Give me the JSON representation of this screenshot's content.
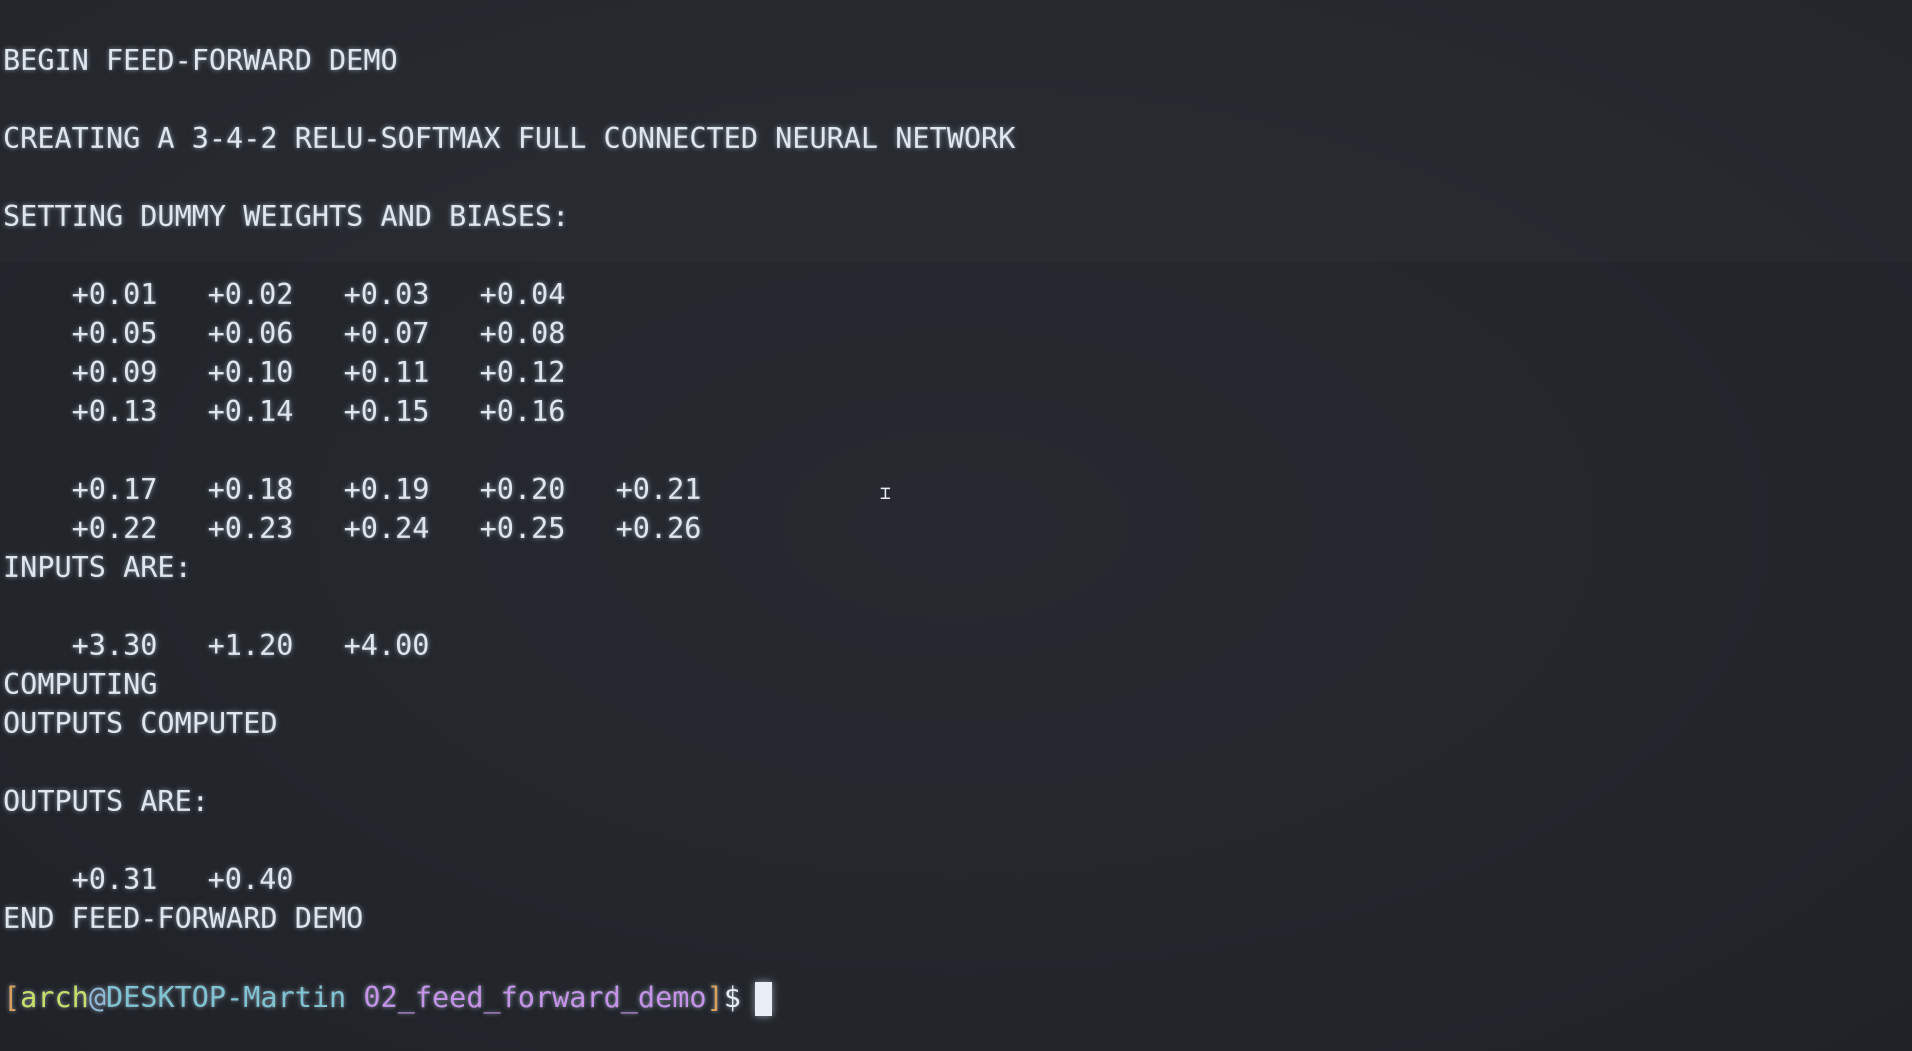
{
  "terminal": {
    "lines": {
      "begin": "BEGIN FEED-FORWARD DEMO",
      "creating": "CREATING A 3-4-2 RELU-SOFTMAX FULL CONNECTED NEURAL NETWORK",
      "setting": "SETTING DUMMY WEIGHTS AND BIASES:",
      "inputs_header": "INPUTS ARE:",
      "computing": "COMPUTING",
      "outputs_computed": "OUTPUTS COMPUTED",
      "outputs_header": "OUTPUTS ARE:",
      "end": "END FEED-FORWARD DEMO"
    },
    "weights_block_1": [
      [
        "+0.01",
        "+0.02",
        "+0.03",
        "+0.04"
      ],
      [
        "+0.05",
        "+0.06",
        "+0.07",
        "+0.08"
      ],
      [
        "+0.09",
        "+0.10",
        "+0.11",
        "+0.12"
      ],
      [
        "+0.13",
        "+0.14",
        "+0.15",
        "+0.16"
      ]
    ],
    "weights_block_2": [
      [
        "+0.17",
        "+0.18",
        "+0.19",
        "+0.20",
        "+0.21"
      ],
      [
        "+0.22",
        "+0.23",
        "+0.24",
        "+0.25",
        "+0.26"
      ]
    ],
    "inputs": [
      "+3.30",
      "+1.20",
      "+4.00"
    ],
    "outputs": [
      "+0.31",
      "+0.40"
    ],
    "prompt": {
      "open_bracket": "[",
      "user": "arch",
      "at": "@",
      "host": "DESKTOP-Martin",
      "space": " ",
      "dir": "02_feed_forward_demo",
      "close_bracket": "]",
      "dollar": "$"
    },
    "mouse_cursor_icon": "i-beam-cursor-icon",
    "colors": {
      "background": "#23272c",
      "text": "#dfe6ee",
      "prompt_bracket": "#d9a05a",
      "prompt_user": "#c8e06a",
      "prompt_host": "#80c4d4",
      "prompt_dir": "#c792ea"
    }
  }
}
